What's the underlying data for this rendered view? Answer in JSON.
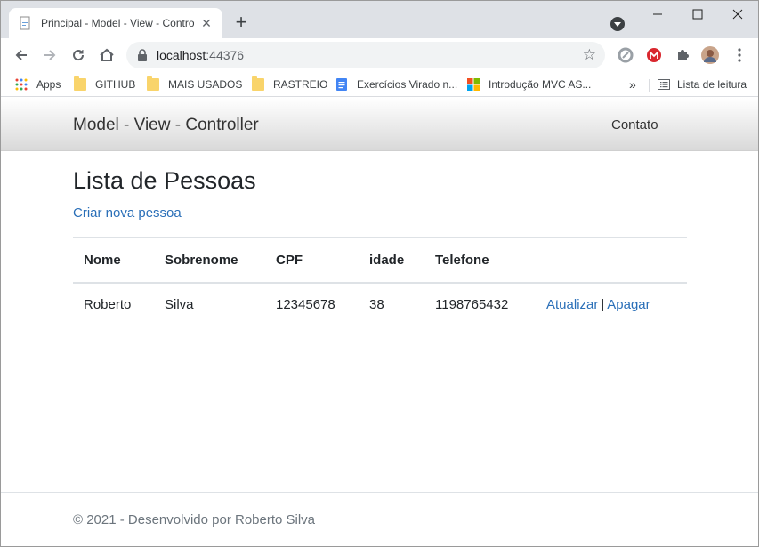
{
  "browser": {
    "tab_title": "Principal - Model - View - Contro",
    "new_tab_glyph": "+",
    "url_host": "localhost",
    "url_port": ":44376",
    "window_controls": [
      "–",
      "☐",
      "✕"
    ]
  },
  "bookmarks": {
    "items": [
      {
        "label": "Apps",
        "icon": "apps-grid-icon"
      },
      {
        "label": "GITHUB",
        "icon": "folder-icon"
      },
      {
        "label": "MAIS USADOS",
        "icon": "folder-icon"
      },
      {
        "label": "RASTREIO",
        "icon": "folder-icon"
      },
      {
        "label": "Exercícios Virado n...",
        "icon": "google-docs-icon"
      },
      {
        "label": "Introdução MVC AS...",
        "icon": "microsoft-logo-icon"
      }
    ],
    "overflow_glyph": "»",
    "reading_list": "Lista de leitura"
  },
  "site": {
    "brand": "Model - View - Controller",
    "nav_contact": "Contato"
  },
  "main": {
    "heading": "Lista de Pessoas",
    "create_link": "Criar nova pessoa",
    "table": {
      "columns": [
        "Nome",
        "Sobrenome",
        "CPF",
        "idade",
        "Telefone"
      ],
      "rows": [
        {
          "nome": "Roberto",
          "sobrenome": "Silva",
          "cpf": "12345678",
          "idade": "38",
          "telefone": "1198765432"
        }
      ],
      "action_update": "Atualizar",
      "action_separator": "|",
      "action_delete": "Apagar"
    }
  },
  "footer": {
    "text": "© 2021 - Desenvolvido por Roberto Silva"
  },
  "colors": {
    "link": "#2a6fb8",
    "tabstrip": "#dee1e6",
    "folder": "#f9d46b"
  }
}
